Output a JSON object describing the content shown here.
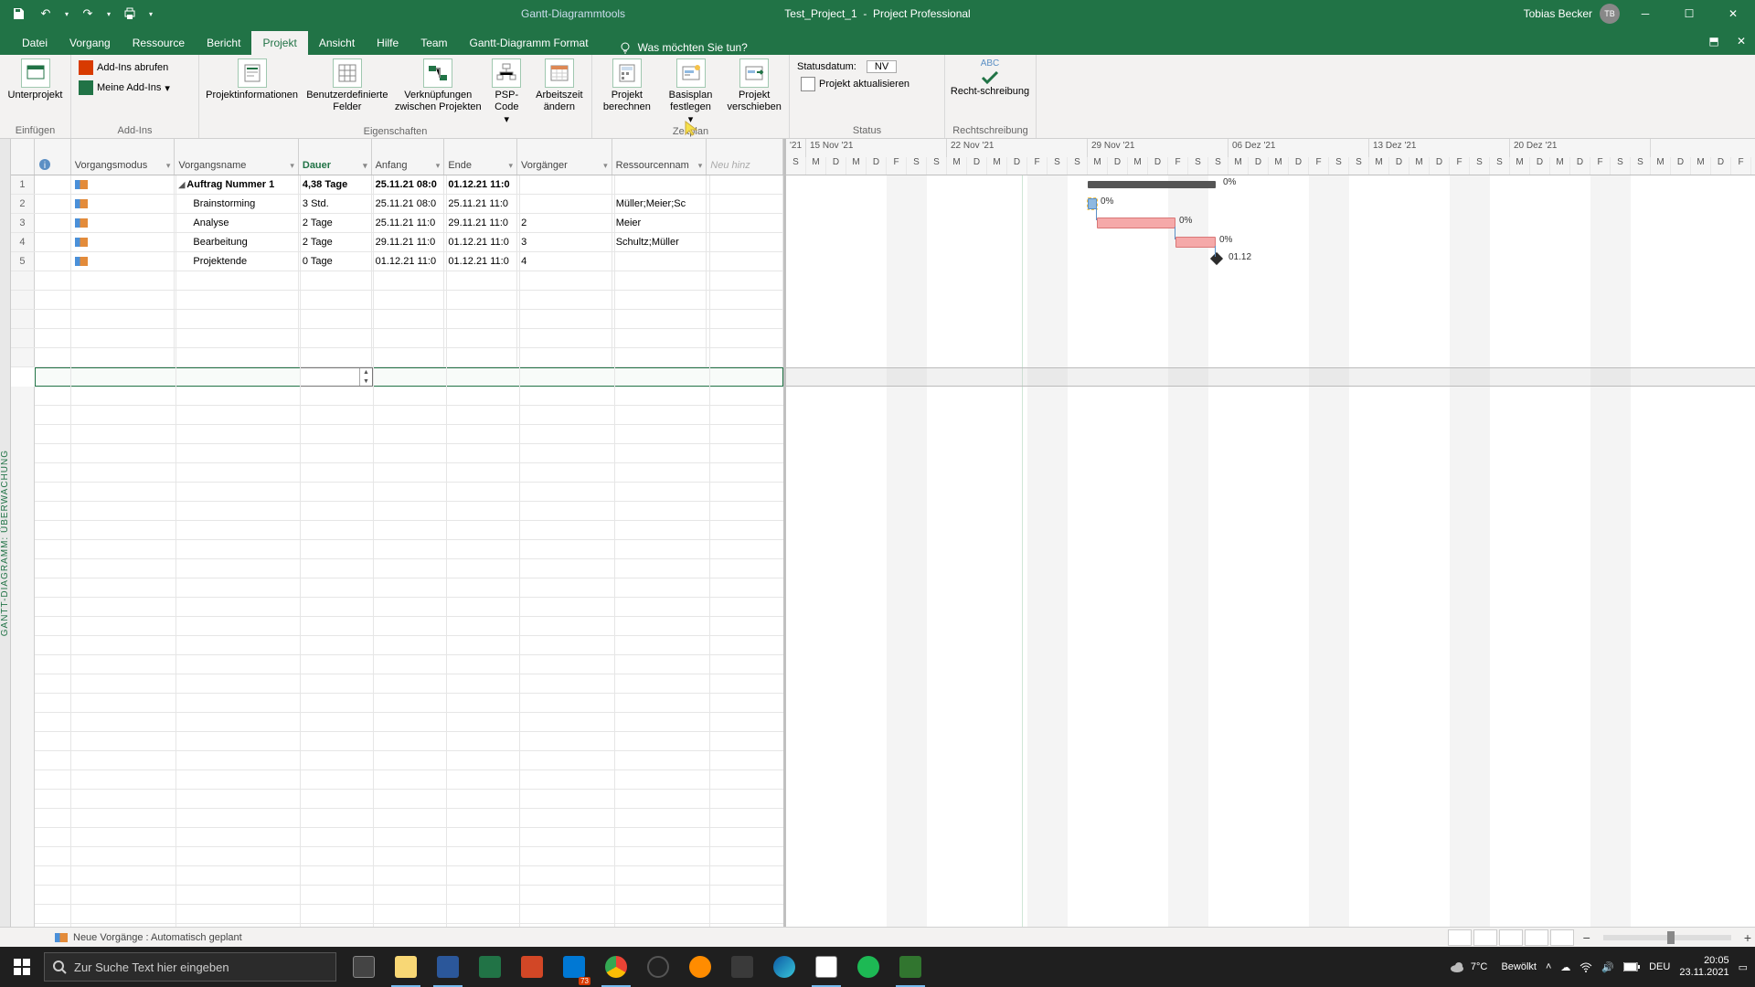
{
  "title": {
    "tools": "Gantt-Diagrammtools",
    "doc": "Test_Project_1",
    "app": "Project Professional",
    "user": "Tobias Becker",
    "initials": "TB"
  },
  "tabs": {
    "t0": "Datei",
    "t1": "Vorgang",
    "t2": "Ressource",
    "t3": "Bericht",
    "t4": "Projekt",
    "t5": "Ansicht",
    "t6": "Hilfe",
    "t7": "Team",
    "t8": "Gantt-Diagramm Format",
    "tell": "Was möchten Sie tun?"
  },
  "ribbon": {
    "g_insert": "Einfügen",
    "g_addins": "Add-Ins",
    "g_props": "Eigenschaften",
    "g_plan": "Zeitplan",
    "g_status": "Status",
    "g_proof": "Rechtschreibung",
    "b_subproj": "Unterprojekt",
    "b_addins_get": "Add-Ins abrufen",
    "b_myaddins": "Meine Add-Ins",
    "b_projinfo": "Projektinformationen",
    "b_custom": "Benutzerdefinierte Felder",
    "b_links": "Verknüpfungen zwischen Projekten",
    "b_psp": "PSP-Code",
    "b_arbeitszeit": "Arbeitszeit ändern",
    "b_calc": "Projekt berechnen",
    "b_baseline": "Basisplan festlegen",
    "b_move": "Projekt verschieben",
    "statusdate_lbl": "Statusdatum:",
    "statusdate_val": "NV",
    "b_update": "Projekt aktualisieren",
    "b_spell": "Recht-schreibung",
    "abc": "ABC"
  },
  "view_label": "GANTT-DIAGRAMM: ÜBERWACHUNG",
  "columns": {
    "info": "",
    "mode": "Vorgangsmodus",
    "name": "Vorgangsname",
    "dur": "Dauer",
    "start": "Anfang",
    "end": "Ende",
    "pred": "Vorgänger",
    "res": "Ressourcennam",
    "new": "Neu hinz"
  },
  "rows": [
    {
      "n": "1",
      "name": "Auftrag Nummer 1",
      "dur": "4,38 Tage",
      "start": "25.11.21 08:0",
      "end": "01.12.21 11:0",
      "pred": "",
      "res": "",
      "summary": true
    },
    {
      "n": "2",
      "name": "Brainstorming",
      "dur": "3 Std.",
      "start": "25.11.21 08:0",
      "end": "25.11.21 11:0",
      "pred": "",
      "res": "Müller;Meier;Sc"
    },
    {
      "n": "3",
      "name": "Analyse",
      "dur": "2 Tage",
      "start": "25.11.21 11:0",
      "end": "29.11.21 11:0",
      "pred": "2",
      "res": "Meier"
    },
    {
      "n": "4",
      "name": "Bearbeitung",
      "dur": "2 Tage",
      "start": "29.11.21 11:0",
      "end": "01.12.21 11:0",
      "pred": "3",
      "res": "Schultz;Müller"
    },
    {
      "n": "5",
      "name": "Projektende",
      "dur": "0 Tage",
      "start": "01.12.21 11:0",
      "end": "01.12.21 11:0",
      "pred": "4",
      "res": ""
    }
  ],
  "timescale": {
    "weeks": [
      "'21",
      "15 Nov '21",
      "22 Nov '21",
      "29 Nov '21",
      "06 Dez '21",
      "13 Dez '21",
      "20 Dez '21"
    ],
    "days": [
      "M",
      "D",
      "M",
      "D",
      "F",
      "S",
      "S"
    ]
  },
  "gantt_labels": {
    "r1": "0%",
    "r2": "0%",
    "r3": "0%",
    "r4": "0%",
    "ms": "01.12"
  },
  "status_strip": "Neue Vorgänge : Automatisch geplant",
  "taskbar": {
    "search_ph": "Zur Suche Text hier eingeben",
    "weather": "Bewölkt",
    "temp": "7°C",
    "lang": "DEU",
    "time": "20:05",
    "date": "23.11.2021",
    "mail_badge": "73"
  }
}
